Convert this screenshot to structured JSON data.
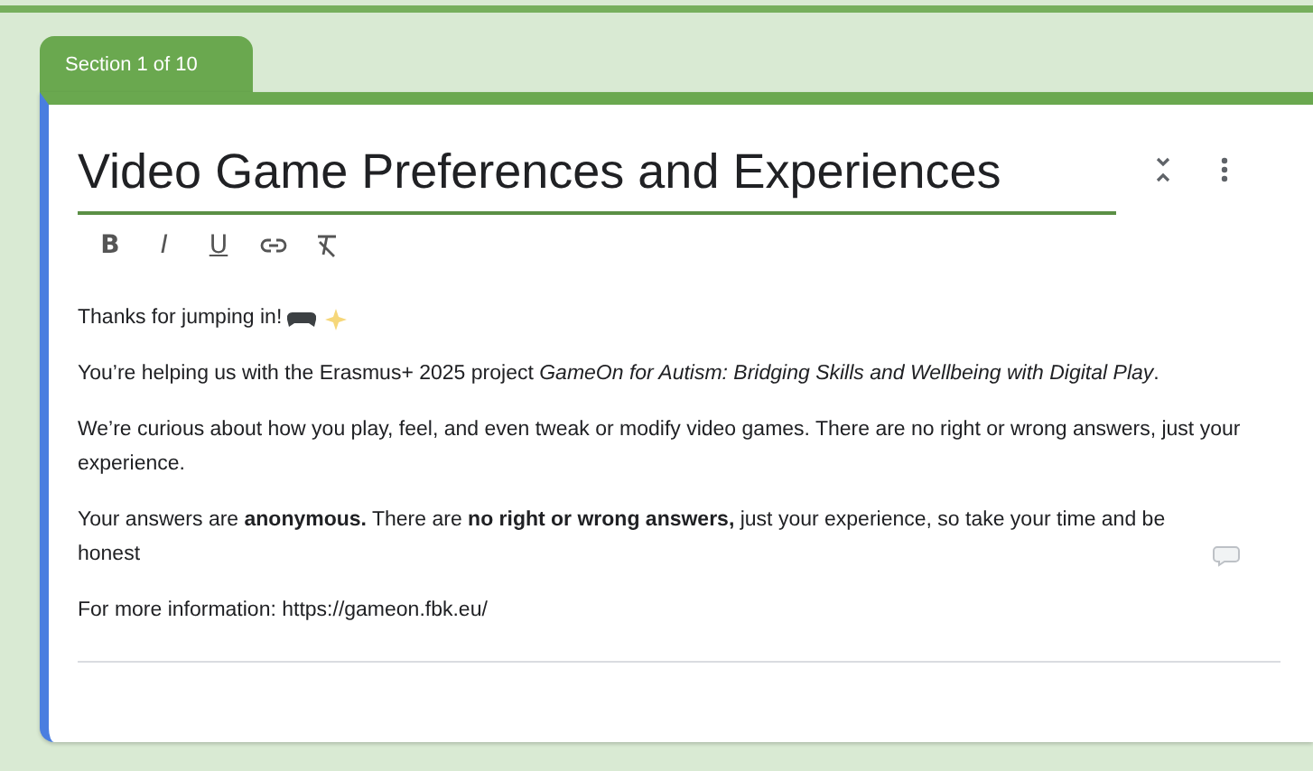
{
  "section_tab": {
    "label": "Section 1 of 10"
  },
  "title": {
    "value": "Video Game Preferences and Experiences"
  },
  "format_toolbar": [
    {
      "kind": "text",
      "label": "B"
    },
    {
      "kind": "text",
      "label": "I"
    },
    {
      "kind": "text",
      "label": "U"
    },
    {
      "kind": "link"
    },
    {
      "kind": "clear"
    }
  ],
  "description": [
    {
      "kind": "game",
      "text": "Thanks for jumping in!"
    },
    {
      "kind": "plain",
      "text": "You’re helping us with the Erasmus+ 2025 project *GameOn for Autism: Bridging Skills and Wellbeing with Digital Play*."
    },
    {
      "kind": "plain",
      "text": "We’re curious about how you play, feel, and even tweak or modify video games. There are no right or wrong answers, just your experience."
    },
    {
      "kind": "chat",
      "text": "Your answers are **anonymous.** There are **no right or wrong answers,** just your experience, so take your time and be honest"
    },
    {
      "kind": "plain",
      "text": "For more information: https://gameon.fbk.eu/"
    }
  ]
}
